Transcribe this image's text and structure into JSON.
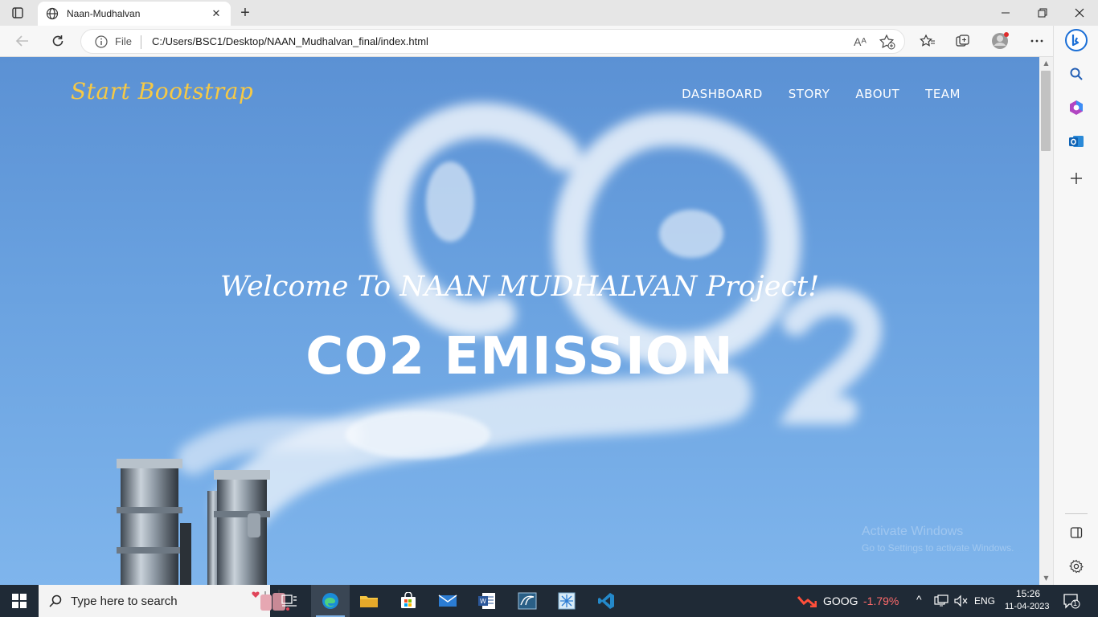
{
  "browser": {
    "tab_title": "Naan-Mudhalvan",
    "omnibox_scheme": "File",
    "url": "C:/Users/BSC1/Desktop/NAAN_Mudhalvan_final/index.html",
    "read_aloud": "Aᴬ"
  },
  "site": {
    "brand": "Start Bootstrap",
    "nav": [
      "DASHBOARD",
      "STORY",
      "ABOUT",
      "TEAM"
    ],
    "hero_subtitle": "Welcome To NAAN MUDHALVAN Project!",
    "hero_title": "CO2 EMISSION"
  },
  "watermark": {
    "line1": "Activate Windows",
    "line2": "Go to Settings to activate Windows."
  },
  "taskbar": {
    "search_placeholder": "Type here to search",
    "stock_symbol": "GOOG",
    "stock_change": "-1.79%",
    "language": "ENG",
    "time": "15:26",
    "date": "11-04-2023",
    "notification_count": "1"
  },
  "colors": {
    "brand": "#f6c945",
    "sky": "#6aa2e0",
    "stock_down": "#ff6b6b",
    "taskbar": "#1f2a36"
  }
}
